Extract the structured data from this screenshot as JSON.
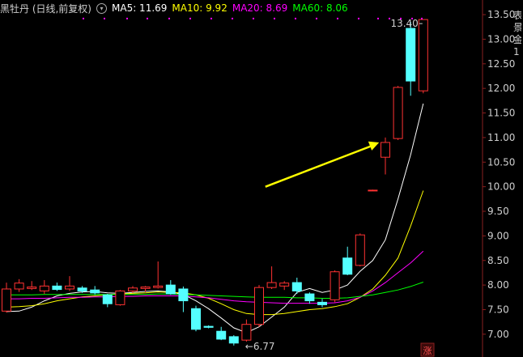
{
  "header": {
    "title": "黑牡丹 (日线,前复权)",
    "options_icon": "circle-chevron-down-icon",
    "ma5": "MA5: 11.69",
    "ma10": "MA10: 9.92",
    "ma20": "MA20: 8.69",
    "ma60": "MA60: 8.06"
  },
  "colors": {
    "background": "#000000",
    "up": "#ff3232",
    "down": "#54ffff",
    "ma5": "#ffffff",
    "ma10": "#ffff00",
    "ma20": "#ff00ff",
    "ma60": "#00ff00",
    "arrow": "#ffff00",
    "axis_text": "#cfcfcf",
    "title": "#cfcfcf"
  },
  "edge_chars": "表景金1",
  "limit_badge": "涨",
  "chart_data": {
    "type": "candlestick",
    "title": "黑牡丹 (日线,前复权)",
    "y_range": [
      6.8,
      13.6
    ],
    "y_ticks": [
      "13.50",
      "13.00",
      "12.50",
      "12.00",
      "11.50",
      "11.00",
      "10.50",
      "10.00",
      "9.50",
      "9.00",
      "8.50",
      "8.00",
      "7.50",
      "7.00"
    ],
    "high_label": "13.40",
    "low_label": "6.77",
    "candles": [
      {
        "o": 7.47,
        "h": 8.05,
        "l": 7.44,
        "c": 7.92
      },
      {
        "o": 7.92,
        "h": 8.12,
        "l": 7.86,
        "c": 8.04
      },
      {
        "o": 7.93,
        "h": 8.08,
        "l": 7.9,
        "c": 7.96
      },
      {
        "o": 7.88,
        "h": 8.1,
        "l": 7.82,
        "c": 7.98
      },
      {
        "o": 7.98,
        "h": 8.05,
        "l": 7.88,
        "c": 7.91
      },
      {
        "o": 7.92,
        "h": 8.18,
        "l": 7.88,
        "c": 7.98
      },
      {
        "o": 7.94,
        "h": 7.98,
        "l": 7.84,
        "c": 7.88
      },
      {
        "o": 7.9,
        "h": 7.98,
        "l": 7.8,
        "c": 7.84
      },
      {
        "o": 7.8,
        "h": 7.82,
        "l": 7.55,
        "c": 7.62
      },
      {
        "o": 7.6,
        "h": 7.9,
        "l": 7.58,
        "c": 7.88
      },
      {
        "o": 7.88,
        "h": 7.98,
        "l": 7.84,
        "c": 7.94
      },
      {
        "o": 7.93,
        "h": 7.98,
        "l": 7.86,
        "c": 7.96
      },
      {
        "o": 7.95,
        "h": 8.48,
        "l": 7.93,
        "c": 7.98
      },
      {
        "o": 8.0,
        "h": 8.1,
        "l": 7.8,
        "c": 7.82
      },
      {
        "o": 7.92,
        "h": 7.97,
        "l": 7.45,
        "c": 7.68
      },
      {
        "o": 7.52,
        "h": 7.58,
        "l": 7.06,
        "c": 7.1
      },
      {
        "o": 7.16,
        "h": 7.18,
        "l": 7.12,
        "c": 7.14
      },
      {
        "o": 7.06,
        "h": 7.15,
        "l": 6.88,
        "c": 6.9
      },
      {
        "o": 6.95,
        "h": 6.98,
        "l": 6.77,
        "c": 6.82
      },
      {
        "o": 6.88,
        "h": 7.3,
        "l": 6.85,
        "c": 7.2
      },
      {
        "o": 7.2,
        "h": 8.0,
        "l": 7.15,
        "c": 7.95
      },
      {
        "o": 7.95,
        "h": 8.38,
        "l": 7.92,
        "c": 8.05
      },
      {
        "o": 7.98,
        "h": 8.08,
        "l": 7.9,
        "c": 8.04
      },
      {
        "o": 8.05,
        "h": 8.15,
        "l": 7.82,
        "c": 7.88
      },
      {
        "o": 7.82,
        "h": 7.85,
        "l": 7.62,
        "c": 7.68
      },
      {
        "o": 7.65,
        "h": 7.72,
        "l": 7.55,
        "c": 7.6
      },
      {
        "o": 7.7,
        "h": 8.3,
        "l": 7.65,
        "c": 8.27
      },
      {
        "o": 8.55,
        "h": 8.78,
        "l": 8.2,
        "c": 8.22
      },
      {
        "o": 8.4,
        "h": 9.05,
        "l": 8.38,
        "c": 9.02
      },
      {
        "o": 9.93,
        "h": 9.94,
        "l": 9.92,
        "c": 9.93
      },
      {
        "o": 10.6,
        "h": 11.0,
        "l": 10.25,
        "c": 10.9
      },
      {
        "o": 10.98,
        "h": 12.05,
        "l": 10.95,
        "c": 12.02
      },
      {
        "o": 13.22,
        "h": 13.35,
        "l": 11.85,
        "c": 12.15
      },
      {
        "o": 11.95,
        "h": 13.4,
        "l": 11.9,
        "c": 13.4
      }
    ],
    "moving_averages": [
      {
        "name": "MA5",
        "values": [
          7.46,
          7.47,
          7.55,
          7.68,
          7.78,
          7.83,
          7.86,
          7.87,
          7.84,
          7.83,
          7.85,
          7.87,
          7.88,
          7.86,
          7.81,
          7.68,
          7.52,
          7.33,
          7.13,
          7.03,
          7.15,
          7.35,
          7.55,
          7.85,
          7.93,
          7.85,
          7.9,
          8.0,
          8.28,
          8.5,
          8.92,
          9.75,
          10.65,
          11.69
        ]
      },
      {
        "name": "MA10",
        "values": [
          7.55,
          7.56,
          7.58,
          7.62,
          7.68,
          7.72,
          7.76,
          7.78,
          7.8,
          7.82,
          7.83,
          7.84,
          7.86,
          7.85,
          7.84,
          7.8,
          7.73,
          7.62,
          7.5,
          7.42,
          7.4,
          7.4,
          7.42,
          7.46,
          7.5,
          7.52,
          7.56,
          7.62,
          7.75,
          7.92,
          8.2,
          8.55,
          9.2,
          9.92
        ]
      },
      {
        "name": "MA20",
        "values": [
          7.72,
          7.72,
          7.73,
          7.73,
          7.74,
          7.75,
          7.75,
          7.76,
          7.76,
          7.77,
          7.77,
          7.78,
          7.78,
          7.78,
          7.78,
          7.76,
          7.74,
          7.71,
          7.68,
          7.66,
          7.65,
          7.64,
          7.63,
          7.63,
          7.63,
          7.63,
          7.64,
          7.68,
          7.75,
          7.88,
          8.05,
          8.25,
          8.45,
          8.69
        ]
      },
      {
        "name": "MA60",
        "values": [
          7.8,
          7.8,
          7.8,
          7.81,
          7.81,
          7.81,
          7.81,
          7.81,
          7.81,
          7.81,
          7.81,
          7.81,
          7.82,
          7.82,
          7.81,
          7.8,
          7.79,
          7.78,
          7.77,
          7.76,
          7.75,
          7.75,
          7.75,
          7.74,
          7.74,
          7.73,
          7.73,
          7.74,
          7.77,
          7.8,
          7.85,
          7.9,
          7.97,
          8.06
        ]
      }
    ],
    "gap_dot_level": 13.42,
    "annotation": {
      "type": "arrow",
      "from_candle": 20.5,
      "from_value": 10.0,
      "to_candle": 29.5,
      "to_value": 10.9
    }
  }
}
